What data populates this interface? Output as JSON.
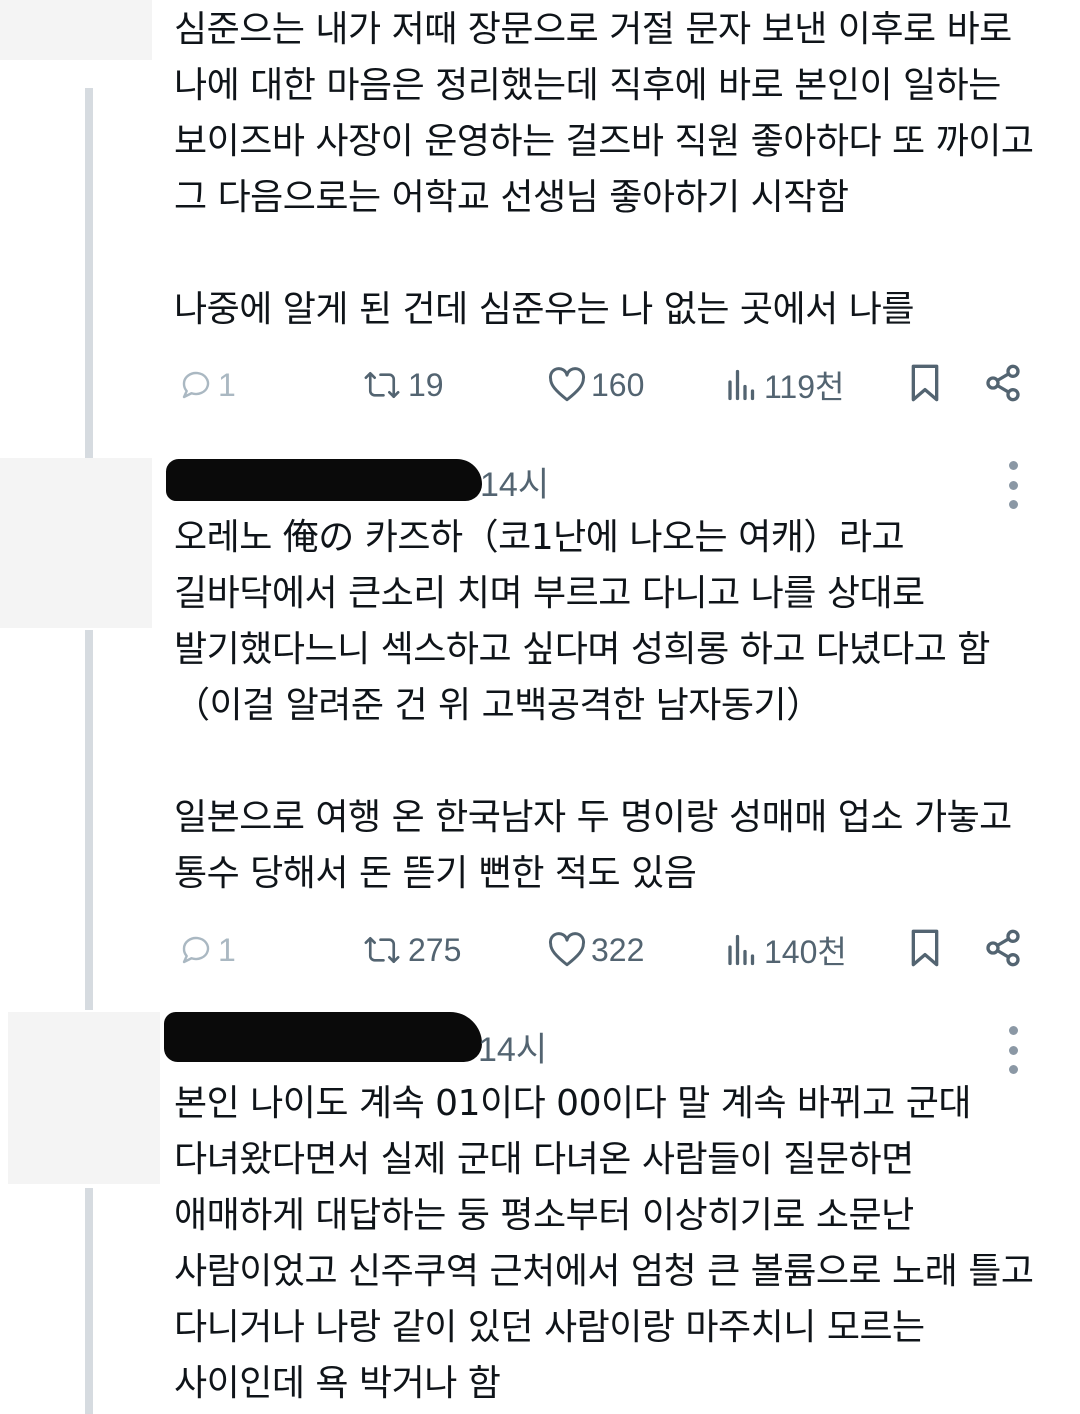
{
  "tweets": [
    {
      "lines": [
        "심준으는 내가 저때 장문으로 거절 문자 보낸 이후로 바로",
        "나에 대한 마음은 정리했는데 직후에 바로 본인이 일하는",
        "보이즈바 사장이 운영하는 걸즈바 직원 좋아하다 또 까이고",
        "그 다음으로는 어학교 선생님 좋아하기 시작함",
        "",
        "나중에 알게 된 건데 심준우는 나 없는 곳에서 나를"
      ],
      "actions": {
        "replies": "1",
        "retweets": "19",
        "likes": "160",
        "views": "119천"
      }
    },
    {
      "time": "14시",
      "lines": [
        "오레노 俺の 카즈하（코1난에 나오는 여캐）라고",
        "길바닥에서 큰소리 치며 부르고 다니고 나를 상대로",
        "발기했다느니 섹스하고 싶다며 성희롱 하고 다녔다고 함",
        "（이걸 알려준 건 위 고백공격한 남자동기）",
        "",
        "일본으로 여행 온 한국남자 두 명이랑 성매매 업소 가놓고",
        "통수 당해서 돈 뜯기 뻔한 적도 있음"
      ],
      "actions": {
        "replies": "1",
        "retweets": "275",
        "likes": "322",
        "views": "140천"
      }
    },
    {
      "time": "14시",
      "lines": [
        "본인 나이도 계속 01이다 00이다 말 계속 바뀌고 군대",
        "다녀왔다면서 실제 군대 다녀온 사람들이 질문하면",
        "애매하게 대답하는 둥 평소부터 이상히기로 소문난",
        "사람이었고 신주쿠역 근처에서 엄청 큰 볼륨으로 노래 틀고",
        "다니거나 나랑 같이 있던 사람이랑 마주치니 모르는",
        "사이인데 욕 박거나 함"
      ]
    }
  ],
  "icons": {
    "reply": "reply-icon",
    "retweet": "retweet-icon",
    "like": "heart-icon",
    "views": "views-chart-icon",
    "bookmark": "bookmark-icon",
    "share": "share-icon",
    "more": "more-vertical-icon"
  },
  "colors": {
    "text": "#0f1419",
    "secondary": "#536471",
    "thread_line": "#d6dbe0",
    "redaction": "#0a0a0a"
  }
}
